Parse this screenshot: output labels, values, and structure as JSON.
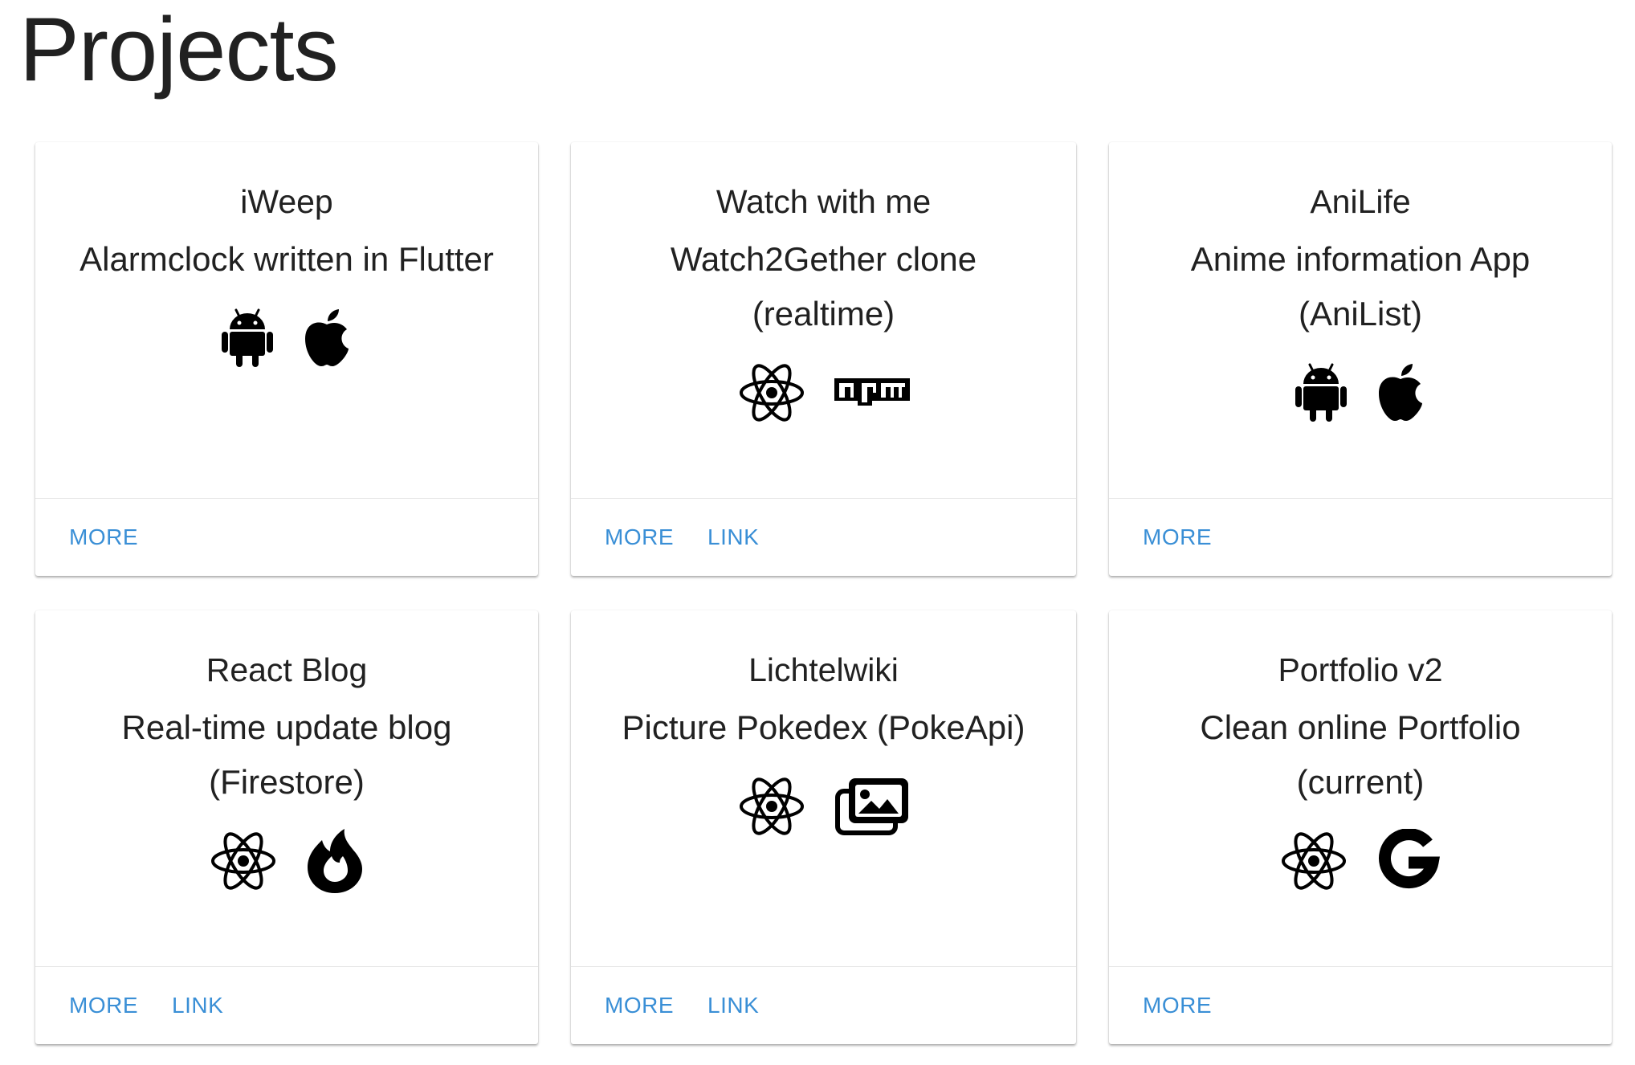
{
  "page": {
    "title": "Projects"
  },
  "colors": {
    "accent": "#3a8fd6",
    "text": "#212121",
    "icon": "#000000"
  },
  "projects": [
    {
      "title": "iWeep",
      "subtitle": "Alarmclock written in Flutter",
      "icons": [
        "android-icon",
        "apple-icon"
      ],
      "actions": [
        "MORE"
      ]
    },
    {
      "title": "Watch with me",
      "subtitle": "Watch2Gether clone (realtime)",
      "icons": [
        "react-icon",
        "npm-icon"
      ],
      "actions": [
        "MORE",
        "LINK"
      ]
    },
    {
      "title": "AniLife",
      "subtitle": "Anime information App (AniList)",
      "icons": [
        "android-icon",
        "apple-icon"
      ],
      "actions": [
        "MORE"
      ]
    },
    {
      "title": "React Blog",
      "subtitle": "Real-time update blog (Firestore)",
      "icons": [
        "react-icon",
        "firebase-flame-icon"
      ],
      "actions": [
        "MORE",
        "LINK"
      ]
    },
    {
      "title": "Lichtelwiki",
      "subtitle": "Picture Pokedex (PokeApi)",
      "icons": [
        "react-icon",
        "image-gallery-icon"
      ],
      "actions": [
        "MORE",
        "LINK"
      ]
    },
    {
      "title": "Portfolio v2",
      "subtitle": "Clean online Portfolio (current)",
      "icons": [
        "react-icon",
        "google-icon"
      ],
      "actions": [
        "MORE"
      ]
    }
  ]
}
